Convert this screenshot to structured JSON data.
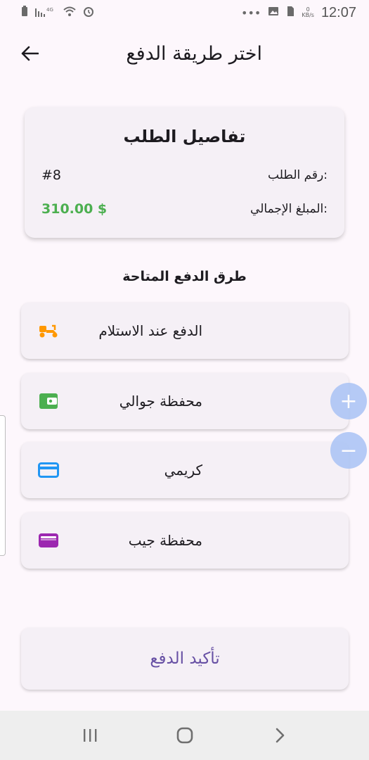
{
  "status_bar": {
    "time": "12:07",
    "speed_value": "0",
    "speed_unit": "KB/s",
    "left_icons": [
      "battery-icon",
      "signal-icon",
      "wifi-icon",
      "alarm-icon"
    ],
    "right_icons": [
      "more-icon",
      "image-icon",
      "sim-icon"
    ],
    "more": "•••"
  },
  "app_bar": {
    "title": "اختر طريقة الدفع",
    "back_icon": "arrow-back-icon"
  },
  "order_card": {
    "title": "تفاصيل الطلب",
    "order_number_label": ":رقم الطلب",
    "order_number_value": "#8",
    "total_label": ":المبلغ الإجمالي",
    "total_value": "310.00 $",
    "total_color": "#4caf50"
  },
  "payment_section": {
    "title": "طرق الدفع المتاحة",
    "methods": [
      {
        "label": "الدفع عند الاستلام",
        "icon": "delivery-scooter-icon",
        "color": "#ff9800"
      },
      {
        "label": "محفظة جوالي",
        "icon": "wallet-icon",
        "color": "#4caf50"
      },
      {
        "label": "كريمي",
        "icon": "credit-card-icon",
        "color": "#2196f3"
      },
      {
        "label": "محفظة جيب",
        "icon": "wallet-purple-icon",
        "color": "#9c27b0"
      }
    ]
  },
  "zoom_controls": {
    "plus": "+",
    "minus": "−"
  },
  "confirm_button": {
    "label": "تأكيد الدفع",
    "color": "#6750a4"
  },
  "nav_bar": {
    "buttons": [
      "recent-apps-icon",
      "home-icon",
      "back-icon"
    ]
  }
}
